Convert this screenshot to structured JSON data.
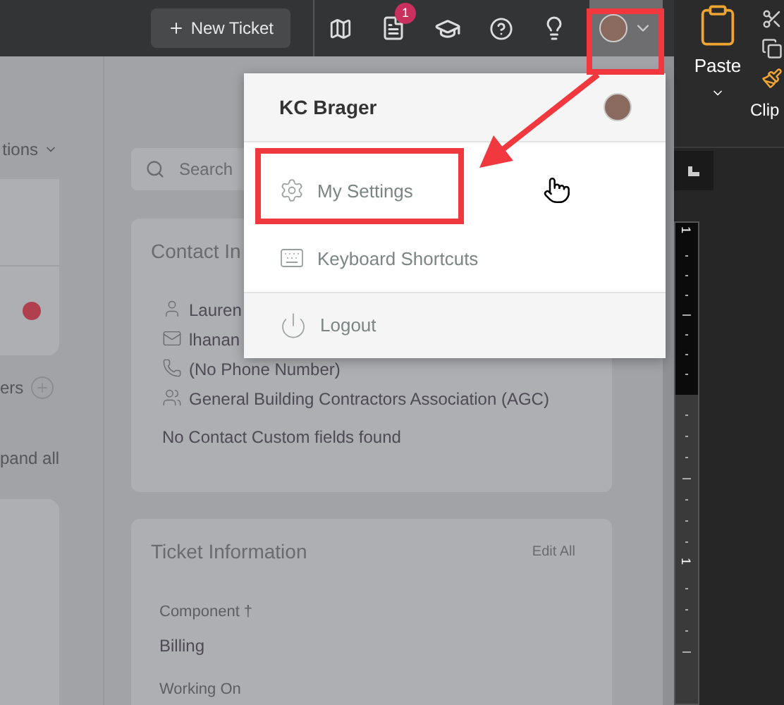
{
  "header": {
    "new_ticket": "New Ticket",
    "notification_badge": "1",
    "avatar_annotated": true
  },
  "user_menu": {
    "name": "KC Brager",
    "items": [
      {
        "kind": "settings",
        "label": "My Settings",
        "annotated": true
      },
      {
        "kind": "keyboard",
        "label": "Keyboard Shortcuts",
        "annotated": false
      }
    ],
    "logout": "Logout"
  },
  "sidebar": {
    "actions_label": "tions",
    "followers_label": "ers",
    "expand_label": "pand all"
  },
  "search": {
    "placeholder": "Search"
  },
  "contact_card": {
    "title": "Contact In",
    "lines": [
      {
        "kind": "person",
        "text": "Lauren"
      },
      {
        "kind": "email",
        "text": "lhanan"
      },
      {
        "kind": "phone",
        "text": "(No Phone Number)"
      },
      {
        "kind": "group",
        "text": "General Building Contractors Association (AGC)"
      }
    ],
    "note": "No Contact Custom fields found"
  },
  "ticket_card": {
    "title": "Ticket Information",
    "edit": "Edit All",
    "fields": [
      {
        "label": "Component †",
        "value": "Billing"
      },
      {
        "label": "Working On"
      }
    ]
  },
  "word": {
    "paste": "Paste",
    "group": "Clip",
    "ruler_marks": [
      "1",
      "1"
    ]
  }
}
